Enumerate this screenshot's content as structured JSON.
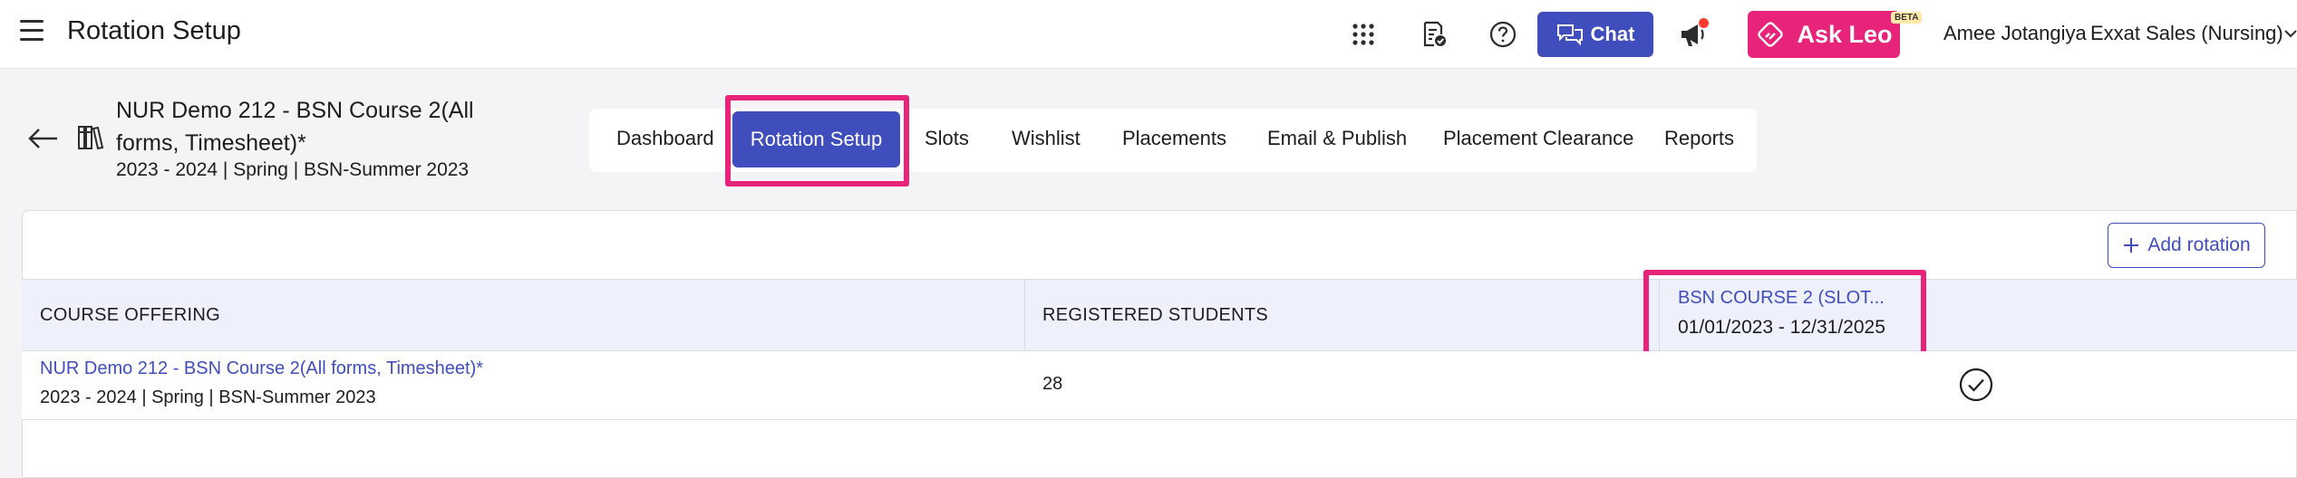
{
  "header": {
    "title": "Rotation Setup",
    "chat_label": "Chat",
    "askleo_label": "Ask Leo",
    "beta_label": "BETA",
    "user_name": "Amee Jotangiya",
    "org_name": "Exxat Sales (Nursing)",
    "icons": [
      "menu-icon",
      "apps-grid-icon",
      "checklist-icon",
      "help-icon",
      "chat-bubble-icon",
      "megaphone-icon",
      "leo-icon",
      "chevron-down-icon"
    ],
    "colors": {
      "primary": "#3f4dbd",
      "askleo": "#e8237a",
      "notification": "#ff3b30"
    }
  },
  "course": {
    "title": "NUR Demo 212 - BSN Course 2(All forms, Timesheet)*",
    "meta": "2023 - 2024 | Spring | BSN-Summer 2023"
  },
  "tabs": [
    {
      "label": "Dashboard",
      "active": false
    },
    {
      "label": "Rotation Setup",
      "active": true
    },
    {
      "label": "Slots",
      "active": false
    },
    {
      "label": "Wishlist",
      "active": false
    },
    {
      "label": "Placements",
      "active": false
    },
    {
      "label": "Email & Publish",
      "active": false
    },
    {
      "label": "Placement Clearance",
      "active": false
    },
    {
      "label": "Reports",
      "active": false
    }
  ],
  "table": {
    "add_rotation_label": "Add rotation",
    "columns": {
      "course_offering": "COURSE OFFERING",
      "registered_students": "REGISTERED STUDENTS",
      "slot_name": "BSN COURSE 2 (SLOT...",
      "slot_dates": "01/01/2023 - 12/31/2025"
    },
    "rows": [
      {
        "course_link": "NUR Demo 212 - BSN Course 2(All forms, Timesheet)*",
        "course_meta": "2023 - 2024 | Spring | BSN-Summer 2023",
        "registered_students": "28",
        "slot_selected": true
      }
    ]
  },
  "highlight_color": "#e8237a"
}
